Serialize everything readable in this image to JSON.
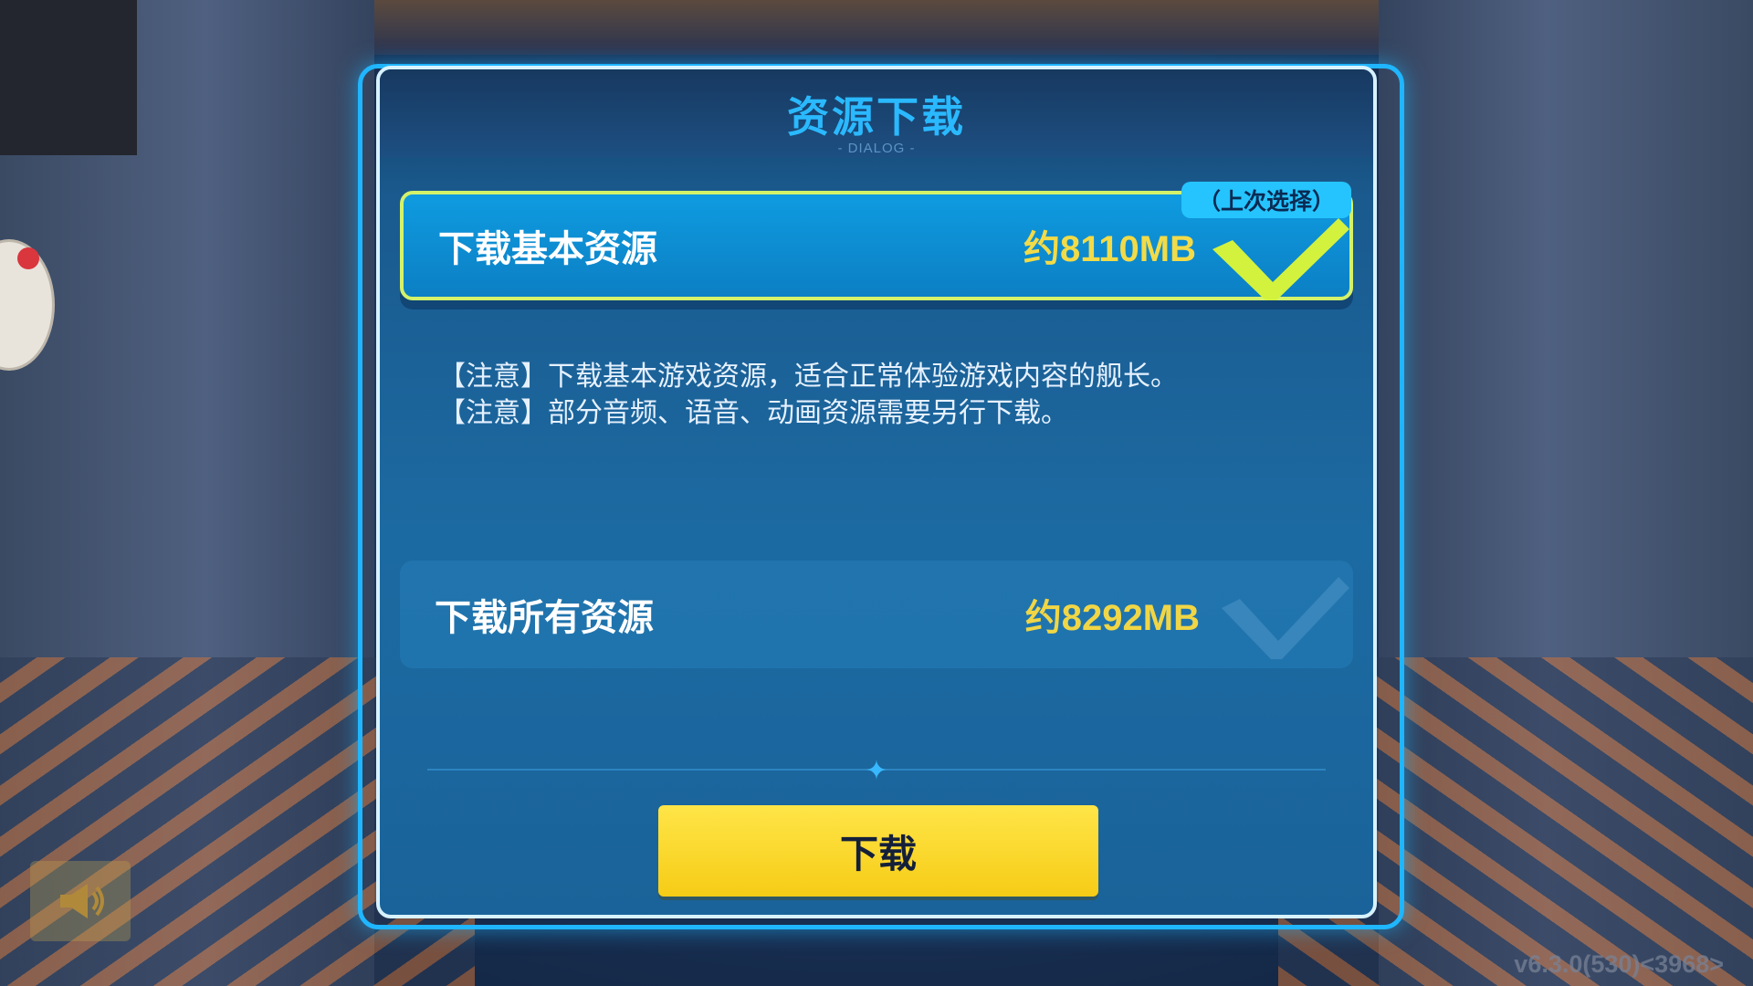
{
  "dialog": {
    "title": "资源下载",
    "subtitle": "- DIALOG -"
  },
  "options": [
    {
      "label": "下载基本资源",
      "size": "约8110MB",
      "badge": "（上次选择）",
      "selected": true
    },
    {
      "label": "下载所有资源",
      "size": "约8292MB",
      "selected": false
    }
  ],
  "notes": [
    "【注意】下载基本游戏资源，适合正常体验游戏内容的舰长。",
    "【注意】部分音频、语音、动画资源需要另行下载。"
  ],
  "download_button": {
    "label": "下载"
  },
  "footer": {
    "version": "v6.3.0(530)<3968>"
  },
  "icons": {
    "selected_check": "check-icon",
    "speaker": "speaker-icon",
    "divider_star": "star-icon"
  },
  "colors": {
    "accent_blue": "#2ab9ff",
    "size_yellow": "#f2db48",
    "selected_border": "#d3f26a",
    "button_yellow": "#ffe548"
  }
}
